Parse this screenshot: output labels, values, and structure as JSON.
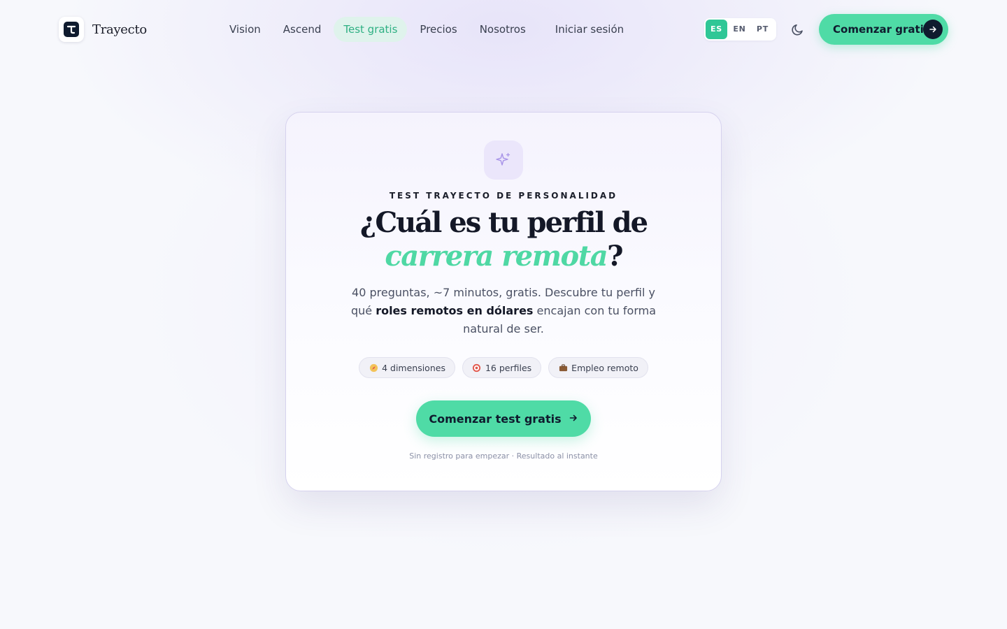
{
  "brand": {
    "name": "Trayecto"
  },
  "nav": {
    "items": [
      {
        "label": "Vision"
      },
      {
        "label": "Ascend"
      },
      {
        "label": "Test gratis"
      },
      {
        "label": "Precios"
      },
      {
        "label": "Nosotros"
      }
    ],
    "login_label": "Iniciar sesión"
  },
  "languages": [
    {
      "code": "ES"
    },
    {
      "code": "EN"
    },
    {
      "code": "PT"
    }
  ],
  "header_cta": {
    "label": "Comenzar gratis"
  },
  "card": {
    "eyebrow": "TEST TRAYECTO DE PERSONALIDAD",
    "title_part1": "¿Cuál es tu perfil de ",
    "title_accent": "carrera remota",
    "title_end": "?",
    "desc_part1": "40 preguntas, ~7 minutos, gratis. Descubre tu perfil y qué ",
    "desc_bold": "roles remotos en dólares",
    "desc_part2": " encajan con tu forma natural de ser.",
    "pills": [
      {
        "icon": "compass-icon",
        "label": "4 dimensiones"
      },
      {
        "icon": "target-icon",
        "label": "16 perfiles"
      },
      {
        "icon": "briefcase-icon",
        "label": "Empleo remoto"
      }
    ],
    "cta_label": "Comenzar test gratis",
    "note": "Sin registro para empezar · Resultado al instante"
  },
  "colors": {
    "accent": "#4fdba6",
    "accent_text": "#2fb083",
    "dark": "#0f1b2e",
    "spark_bg": "#ebe6fb"
  }
}
